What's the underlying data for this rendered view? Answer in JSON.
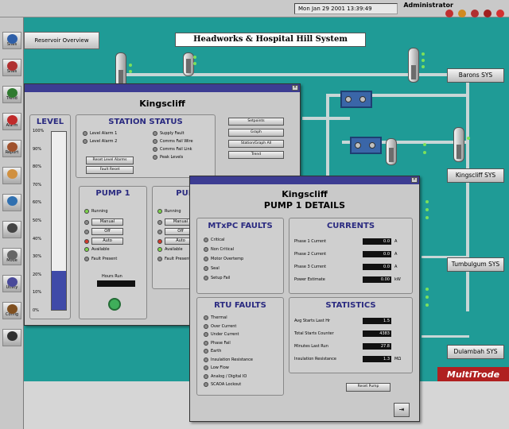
{
  "topbar": {
    "clock": "Mon Jan 29 2001 13:39:49",
    "user": "Administrator"
  },
  "leftbar": {
    "items": [
      {
        "label": "Sites",
        "icon": "globe-icon",
        "color": "#2f5fa8"
      },
      {
        "label": "Sites",
        "icon": "sites-icon",
        "color": "#b03030"
      },
      {
        "label": "Trend",
        "icon": "trend-icon",
        "color": "#2f7a2f"
      },
      {
        "label": "Alarm",
        "icon": "alarm-icon",
        "color": "#c02a2a"
      },
      {
        "label": "Report",
        "icon": "report-icon",
        "color": "#a0522d"
      },
      {
        "label": "",
        "icon": "map-icon",
        "color": "#d09040"
      },
      {
        "label": "",
        "icon": "world-icon",
        "color": "#3070b0"
      },
      {
        "label": "",
        "icon": "chart-icon",
        "color": "#444"
      },
      {
        "label": "Mode",
        "icon": "mode-icon",
        "color": "#666"
      },
      {
        "label": "Utility",
        "icon": "utility-icon",
        "color": "#4a4a9a"
      },
      {
        "label": "Config",
        "icon": "config-icon",
        "color": "#805020"
      },
      {
        "label": "",
        "icon": "exit-icon",
        "color": "#303030"
      }
    ]
  },
  "main": {
    "reservoir_button": "Reservoir Overview",
    "banner": "Headworks & Hospital Hill System",
    "sites": [
      "Barons SYS",
      "Kingscliff SYS",
      "Tumbulgum SYS",
      "Dulambah SYS"
    ],
    "logo": "MultiTrode"
  },
  "overview": {
    "title": "Kingscliff",
    "level_title": "LEVEL",
    "status_title": "STATION STATUS",
    "scale": [
      "100%",
      "90%",
      "80%",
      "70%",
      "60%",
      "50%",
      "40%",
      "30%",
      "20%",
      "10%",
      "0%"
    ],
    "level_pct": 22,
    "alarms_left": [
      "Level Alarm 1",
      "Level Alarm 2"
    ],
    "alarms_right": [
      "Supply Fault",
      "Comms Fail Wire",
      "Comms Fail Link",
      "Peak Levels"
    ],
    "right_buttons": [
      "Setpoints",
      "Graph",
      "Station/Graph All",
      "Trend"
    ],
    "pump_title": "PUMP 1",
    "pump2_title": "PUM",
    "pump_states": [
      "Running",
      "Manual",
      "Off",
      "Auto",
      "Available",
      "Fault Present"
    ],
    "pump_led_colors": [
      "green",
      "gray",
      "gray",
      "red",
      "green",
      "gray"
    ],
    "hours_run_label": "Hours Run"
  },
  "details": {
    "title": "Kingscliff",
    "subtitle": "PUMP 1 DETAILS",
    "mtxpc_title": "MTxPC FAULTS",
    "mtxpc_faults": [
      "Critical",
      "Non Critical",
      "Motor Overtemp",
      "Seal",
      "Setup Fail"
    ],
    "currents_title": "CURRENTS",
    "currents": [
      {
        "label": "Phase 1 Current",
        "value": "0.0",
        "unit": "A"
      },
      {
        "label": "Phase 2 Current",
        "value": "0.0",
        "unit": "A"
      },
      {
        "label": "Phase 3 Current",
        "value": "0.0",
        "unit": "A"
      },
      {
        "label": "Power Estimate",
        "value": "0.00",
        "unit": "kW"
      }
    ],
    "rtu_title": "RTU FAULTS",
    "rtu_faults": [
      "Thermal",
      "Over Current",
      "Under Current",
      "Phase Fail",
      "Earth",
      "Insulation Resistance",
      "Low Flow",
      "Analog / Digital IO",
      "SCADA Lockout"
    ],
    "stats_title": "STATISTICS",
    "stats": [
      {
        "label": "Avg Starts Last Hr",
        "value": "1.5",
        "unit": ""
      },
      {
        "label": "Total Starts Counter",
        "value": "4383",
        "unit": ""
      },
      {
        "label": "Minutes Last Run",
        "value": "27.8",
        "unit": ""
      },
      {
        "label": "Insulation Resistance",
        "value": "1.3",
        "unit": "MΩ"
      }
    ],
    "reset_button": "Reset Pump"
  }
}
